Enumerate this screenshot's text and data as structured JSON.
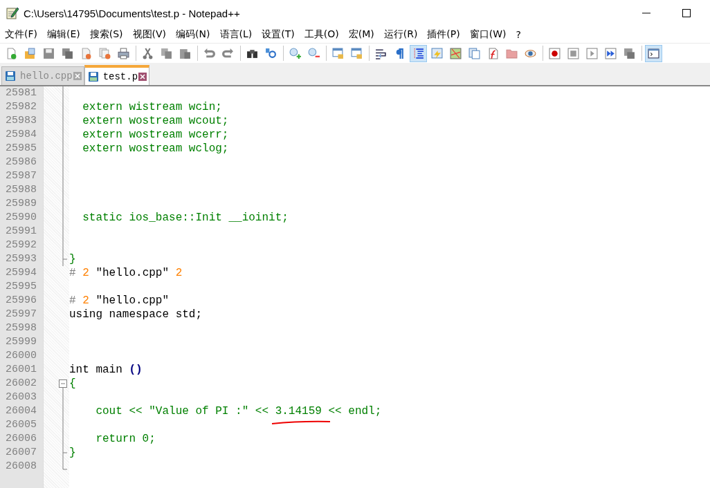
{
  "window": {
    "title": "C:\\Users\\14795\\Documents\\test.p - Notepad++"
  },
  "menu": [
    "文件(F)",
    "编辑(E)",
    "搜索(S)",
    "视图(V)",
    "编码(N)",
    "语言(L)",
    "设置(T)",
    "工具(O)",
    "宏(M)",
    "运行(R)",
    "插件(P)",
    "窗口(W)",
    "?"
  ],
  "toolbar": [
    {
      "kind": "new",
      "selected": false
    },
    {
      "kind": "open",
      "selected": false
    },
    {
      "kind": "save",
      "selected": false
    },
    {
      "kind": "save-all",
      "selected": false
    },
    {
      "kind": "close",
      "selected": false
    },
    {
      "kind": "close-all",
      "selected": false
    },
    {
      "kind": "print",
      "selected": false
    },
    {
      "kind": "separator"
    },
    {
      "kind": "cut",
      "selected": false
    },
    {
      "kind": "copy",
      "selected": false
    },
    {
      "kind": "paste",
      "selected": false
    },
    {
      "kind": "separator"
    },
    {
      "kind": "undo",
      "selected": false
    },
    {
      "kind": "redo",
      "selected": false
    },
    {
      "kind": "separator"
    },
    {
      "kind": "find",
      "selected": false
    },
    {
      "kind": "replace",
      "selected": false
    },
    {
      "kind": "separator"
    },
    {
      "kind": "zoom-in",
      "selected": false
    },
    {
      "kind": "zoom-out",
      "selected": false
    },
    {
      "kind": "separator"
    },
    {
      "kind": "sync-v",
      "selected": false
    },
    {
      "kind": "sync-h",
      "selected": false
    },
    {
      "kind": "separator"
    },
    {
      "kind": "wrap",
      "selected": false
    },
    {
      "kind": "pilcrow",
      "selected": false
    },
    {
      "kind": "indent-guide",
      "selected": true
    },
    {
      "kind": "lang",
      "selected": false
    },
    {
      "kind": "map",
      "selected": false
    },
    {
      "kind": "docs",
      "selected": false
    },
    {
      "kind": "function",
      "selected": false
    },
    {
      "kind": "folder",
      "selected": false
    },
    {
      "kind": "eye",
      "selected": false
    },
    {
      "kind": "separator"
    },
    {
      "kind": "record",
      "selected": false
    },
    {
      "kind": "stop",
      "selected": false
    },
    {
      "kind": "play",
      "selected": false
    },
    {
      "kind": "play-multi",
      "selected": false
    },
    {
      "kind": "save-macro",
      "selected": false
    },
    {
      "kind": "separator"
    },
    {
      "kind": "console",
      "selected": true
    }
  ],
  "tabs": [
    {
      "label": "hello.cpp",
      "selected": false
    },
    {
      "label": "test.p",
      "selected": true
    }
  ],
  "lines": [
    {
      "number": "25981",
      "kind": "fold-line"
    },
    {
      "number": "25982",
      "kind": "fold-line",
      "tokens": [
        {
          "text": "  extern wistream wcin;",
          "kind": "code"
        }
      ]
    },
    {
      "number": "25983",
      "kind": "fold-line",
      "tokens": [
        {
          "text": "  extern wostream wcout;",
          "kind": "code"
        }
      ]
    },
    {
      "number": "25984",
      "kind": "fold-line",
      "tokens": [
        {
          "text": "  extern wostream wcerr;",
          "kind": "code"
        }
      ]
    },
    {
      "number": "25985",
      "kind": "fold-line",
      "tokens": [
        {
          "text": "  extern wostream wclog;",
          "kind": "code"
        }
      ]
    },
    {
      "number": "25986",
      "kind": "fold-line"
    },
    {
      "number": "25987",
      "kind": "fold-line"
    },
    {
      "number": "25988",
      "kind": "fold-line"
    },
    {
      "number": "25989",
      "kind": "fold-line"
    },
    {
      "number": "25990",
      "kind": "fold-line",
      "tokens": [
        {
          "text": "  static ios_base::Init __ioinit;",
          "kind": "code"
        }
      ]
    },
    {
      "number": "25991",
      "kind": "fold-line"
    },
    {
      "number": "25992",
      "kind": "fold-line"
    },
    {
      "number": "25993",
      "kind": "fold-end",
      "tokens": [
        {
          "text": "}",
          "kind": "code"
        }
      ]
    },
    {
      "number": "25994",
      "kind": "plain",
      "tokens": [
        {
          "text": "# ",
          "kind": "directive"
        },
        {
          "text": "2",
          "kind": "number"
        },
        {
          "text": " \"hello.cpp\" ",
          "kind": "plain"
        },
        {
          "text": "2",
          "kind": "number"
        }
      ]
    },
    {
      "number": "25995",
      "kind": "plain"
    },
    {
      "number": "25996",
      "kind": "plain",
      "tokens": [
        {
          "text": "# ",
          "kind": "directive"
        },
        {
          "text": "2",
          "kind": "number"
        },
        {
          "text": " \"hello.cpp\"",
          "kind": "plain"
        }
      ]
    },
    {
      "number": "25997",
      "kind": "plain",
      "tokens": [
        {
          "text": "using namespace std;",
          "kind": "plain"
        }
      ]
    },
    {
      "number": "25998",
      "kind": "plain"
    },
    {
      "number": "25999",
      "kind": "plain"
    },
    {
      "number": "26000",
      "kind": "plain"
    },
    {
      "number": "26001",
      "kind": "plain",
      "tokens": [
        {
          "text": "int main ",
          "kind": "plain"
        },
        {
          "text": "()",
          "kind": "operator"
        }
      ]
    },
    {
      "number": "26002",
      "kind": "fold-open",
      "tokens": [
        {
          "text": "{",
          "kind": "code"
        }
      ]
    },
    {
      "number": "26003",
      "kind": "fold-line"
    },
    {
      "number": "26004",
      "kind": "fold-line",
      "tokens": [
        {
          "text": "    cout << \"Value of PI :\" << ",
          "kind": "code"
        },
        {
          "text": "3.14159",
          "kind": "code",
          "underlined": true
        },
        {
          "text": " << endl;",
          "kind": "code"
        }
      ]
    },
    {
      "number": "26005",
      "kind": "fold-line"
    },
    {
      "number": "26006",
      "kind": "fold-line",
      "tokens": [
        {
          "text": "    return 0;",
          "kind": "code"
        }
      ]
    },
    {
      "number": "26007",
      "kind": "fold-end",
      "tokens": [
        {
          "text": "}",
          "kind": "code"
        }
      ]
    },
    {
      "number": "26008",
      "kind": "fold-corner"
    }
  ]
}
